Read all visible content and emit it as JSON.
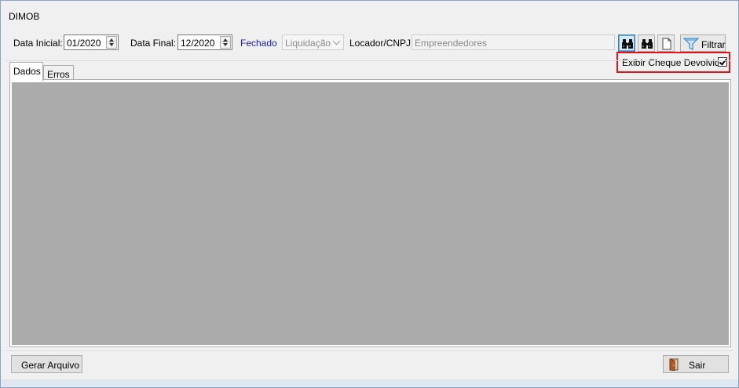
{
  "window": {
    "title": "DIMOB"
  },
  "filters": {
    "data_inicial_label": "Data Inicial:",
    "data_inicial_value": "01/2020",
    "data_final_label": "Data Final:",
    "data_final_value": "12/2020",
    "status_text": "Fechado",
    "tipo_value": "Liquidação",
    "locador_label": "Locador/CNPJ:",
    "locador_value": "Empreendedores",
    "filtrar_label": "Filtrar",
    "exibir_cheque_label": "Exibir Cheque Devolvido",
    "exibir_cheque_checked": true
  },
  "icons": {
    "search": "binoculars-icon",
    "search_alt": "binoculars-icon",
    "new": "document-icon",
    "filter": "funnel-icon",
    "exit": "door-icon"
  },
  "tabs": [
    {
      "label": "Dados",
      "selected": true
    },
    {
      "label": "Erros",
      "selected": false
    }
  ],
  "footer": {
    "gerar_label": "Gerar Arquivo",
    "sair_label": "Sair"
  },
  "colors": {
    "highlight": "#e3141a",
    "status_text": "#1a1ab0",
    "grid_background": "#ababab"
  }
}
